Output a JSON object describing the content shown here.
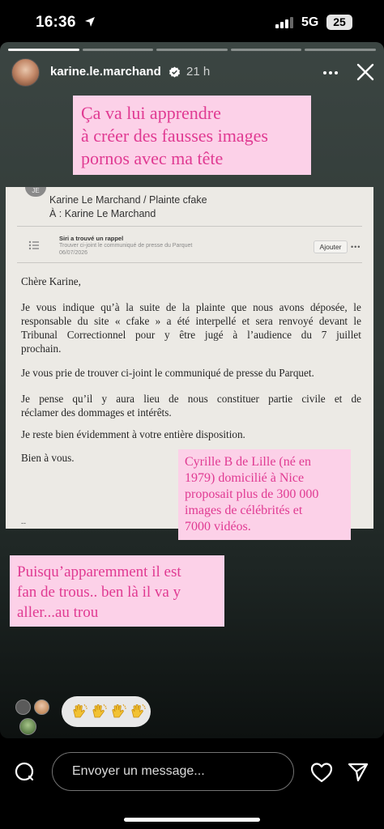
{
  "status_bar": {
    "time": "16:36",
    "network": "5G",
    "battery": "25"
  },
  "story": {
    "username": "karine.le.marchand",
    "time_ago": "21 h",
    "progress": {
      "segments": 5,
      "current": 1
    },
    "caption_top": [
      "Ça va lui apprendre",
      "à créer des fausses images",
      "pornos avec ma tête"
    ],
    "caption_mid": [
      "Cyrille B de Lille (né en",
      "1979) domicilié à Nice",
      "proposait plus de 300 000",
      "images de célébrités et",
      "7000 vidéos."
    ],
    "caption_bottom": [
      "Puisqu’apparemment il est",
      "fan de trous.. ben là il va y",
      "aller...au trou"
    ]
  },
  "document": {
    "avatar_initials": "JE",
    "from": "Karine Le Marchand / Plainte cfake",
    "to": "À :  Karine Le Marchand",
    "siri": {
      "title": "Siri a trouvé un rappel",
      "subtitle": "Trouver ci-joint le communiqué de presse du Parquet",
      "date": "06/07/2026",
      "button": "Ajouter",
      "more": "•••"
    },
    "letter": {
      "salutation": "Chère Karine,",
      "p1_lines": [
        "Je vous indique qu’à la suite de la plainte que nous avons déposée, le",
        "responsable du site « cfake » a été interpellé et sera renvoyé devant le",
        "Tribunal Correctionnel pour y être jugé à l’audience du 7 juillet",
        "prochain."
      ],
      "p2": "Je vous prie de trouver ci-joint le communiqué de presse du Parquet.",
      "p3_lines": [
        "Je pense qu’il y aura lieu de nous constituer partie civile et de",
        "réclamer des dommages et intérêts."
      ],
      "p4": "Je reste bien évidemment à votre entière disposition.",
      "closing": "Bien à vous.",
      "dash": "--"
    }
  },
  "footer": {
    "message_placeholder": "Envoyer un message...",
    "reaction_count": 4,
    "reaction_icon": "clapping-hands-icon"
  },
  "colors": {
    "caption_bg": "#fcd1e8",
    "caption_text": "#e03a92"
  }
}
